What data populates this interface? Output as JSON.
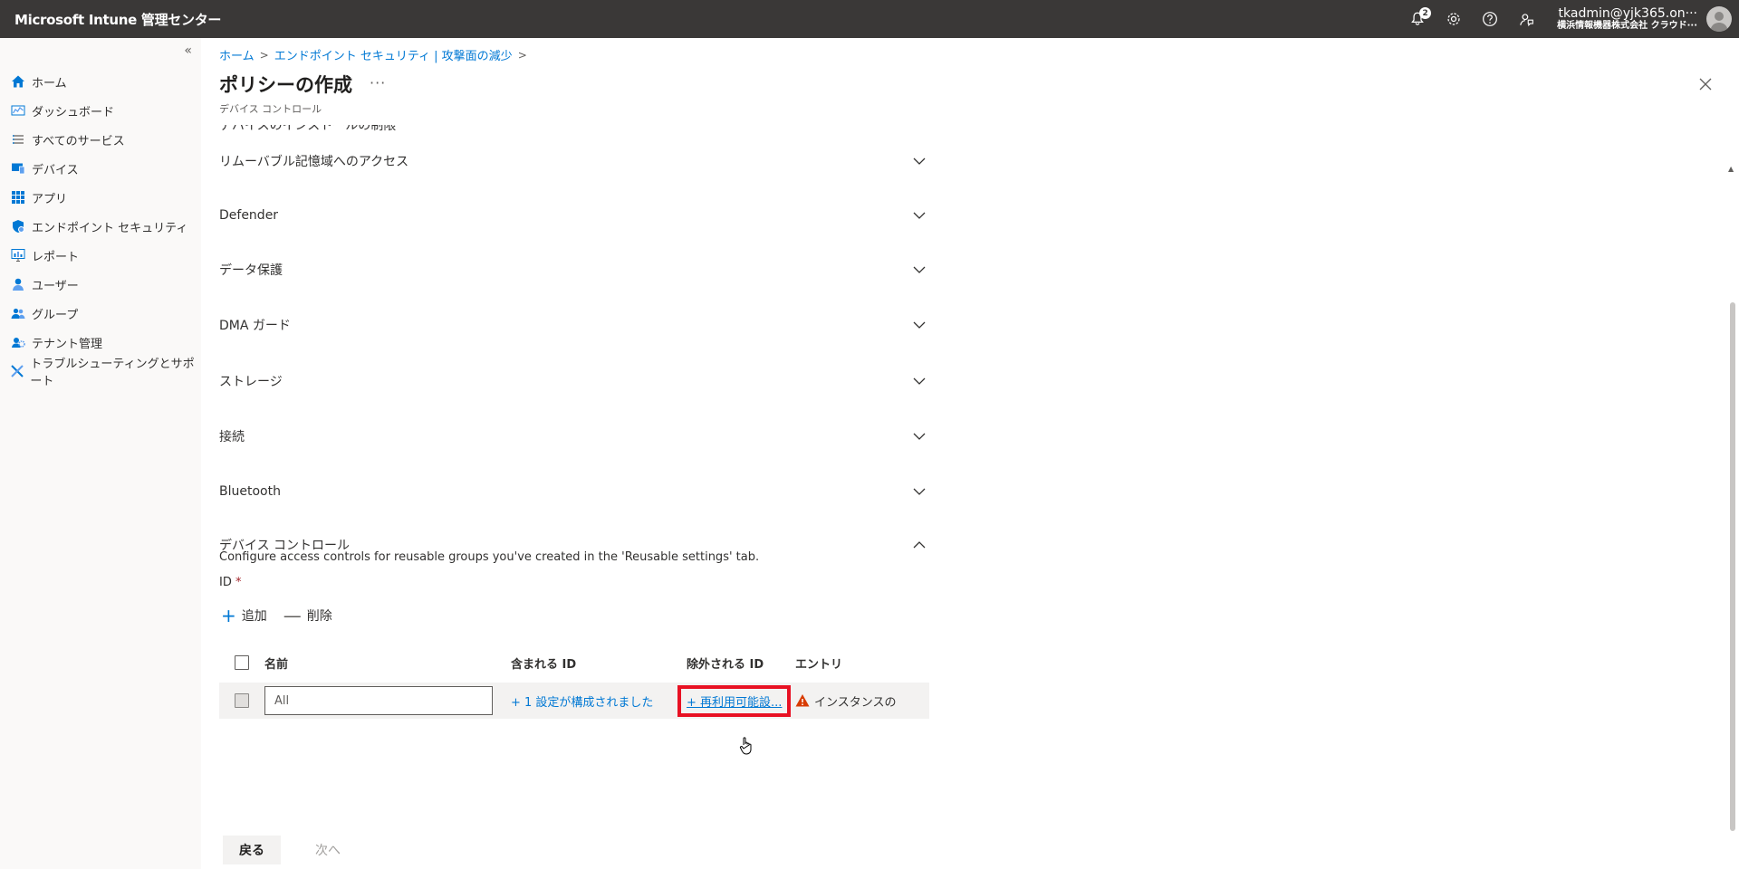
{
  "app": {
    "title": "Microsoft Intune 管理センター"
  },
  "topbar": {
    "notification_count": "2",
    "account_email": "tkadmin@yjk365.on···",
    "account_org": "横浜情報機器株式会社 クラウド···"
  },
  "sidebar": {
    "collapse_glyph": "«",
    "items": [
      {
        "label": "ホーム",
        "icon": "home-icon"
      },
      {
        "label": "ダッシュボード",
        "icon": "dashboard-icon"
      },
      {
        "label": "すべてのサービス",
        "icon": "list-icon"
      },
      {
        "label": "デバイス",
        "icon": "devices-icon"
      },
      {
        "label": "アプリ",
        "icon": "apps-icon"
      },
      {
        "label": "エンドポイント セキュリティ",
        "icon": "shield-icon"
      },
      {
        "label": "レポート",
        "icon": "report-icon"
      },
      {
        "label": "ユーザー",
        "icon": "user-icon"
      },
      {
        "label": "グループ",
        "icon": "group-icon"
      },
      {
        "label": "テナント管理",
        "icon": "tenant-icon"
      },
      {
        "label": "トラブルシューティングとサポート",
        "icon": "tools-icon"
      }
    ]
  },
  "breadcrumb": {
    "items": [
      "ホーム",
      "エンドポイント セキュリティ | 攻撃面の減少"
    ]
  },
  "page": {
    "title": "ポリシーの作成",
    "more": "···",
    "subtitle": "デバイス コントロール"
  },
  "sections": {
    "partial": "デバイスのインストールの制限",
    "items": [
      "リムーバブル記憶域へのアクセス",
      "Defender",
      "データ保護",
      "DMA ガード",
      "ストレージ",
      "接続",
      "Bluetooth",
      "デバイス コントロール"
    ]
  },
  "device_control": {
    "description": "Configure access controls for reusable groups you've created in the 'Reusable settings' tab.",
    "id_label": "ID",
    "required_mark": "*",
    "add_label": "追加",
    "delete_label": "削除",
    "columns": {
      "name": "名前",
      "included": "含まれる ID",
      "excluded": "除外される ID",
      "entry": "エントリ"
    },
    "row": {
      "name_value": "All",
      "included": "+ 1 設定が構成されました",
      "excluded": "+ 再利用可能設...",
      "entry": "インスタンスの"
    }
  },
  "footer": {
    "back": "戻る",
    "next": "次へ"
  },
  "colors": {
    "topbar": "#3a3837",
    "accent": "#0078d4",
    "highlight": "#e81123",
    "warning": "#d83b01"
  }
}
